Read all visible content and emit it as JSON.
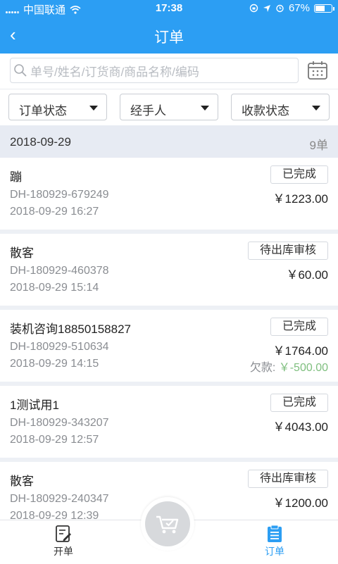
{
  "status": {
    "carrier": "中国联通",
    "time": "17:38",
    "battery": "67%",
    "battery_level": 0.67
  },
  "nav": {
    "back_icon": "‹",
    "title": "订单"
  },
  "search": {
    "placeholder": "单号/姓名/订货商/商品名称/编码"
  },
  "filters": {
    "order_status": "订单状态",
    "handler": "经手人",
    "payment_status": "收款状态"
  },
  "group": {
    "date": "2018-09-29",
    "count": "9单"
  },
  "orders": [
    {
      "name": "蹦",
      "status": "已完成",
      "order_no": "DH-180929-679249",
      "amount": "￥1223.00",
      "time": "2018-09-29 16:27"
    },
    {
      "name": "散客",
      "status": "待出库审核",
      "order_no": "DH-180929-460378",
      "amount": "￥60.00",
      "time": "2018-09-29 15:14"
    },
    {
      "name": "装机咨询18850158827",
      "status": "已完成",
      "order_no": "DH-180929-510634",
      "amount": "￥1764.00",
      "time": "2018-09-29 14:15",
      "debt_label": "欠款:",
      "debt_value": "￥-500.00"
    },
    {
      "name": "1测试用1",
      "status": "已完成",
      "order_no": "DH-180929-343207",
      "amount": "￥4043.00",
      "time": "2018-09-29 12:57"
    },
    {
      "name": "散客",
      "status": "待出库审核",
      "order_no": "DH-180929-240347",
      "amount": "￥1200.00",
      "time": "2018-09-29 12:39"
    }
  ],
  "tabs": {
    "create": "开单",
    "orders": "订单"
  },
  "colors": {
    "primary": "#2c9ef3",
    "debt": "#7fbf7f"
  }
}
